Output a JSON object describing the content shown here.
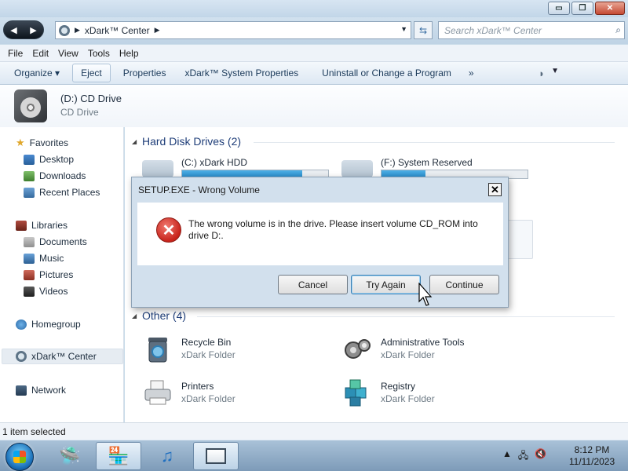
{
  "window": {
    "controls": {
      "minimize": "▭",
      "maximize": "❐",
      "close": "✕"
    }
  },
  "address": {
    "location": "xDark™ Center",
    "search_placeholder": "Search xDark™ Center"
  },
  "menu": [
    "File",
    "Edit",
    "View",
    "Tools",
    "Help"
  ],
  "commands": {
    "organize": "Organize ▾",
    "eject": "Eject",
    "properties": "Properties",
    "system_properties": "xDark™ System Properties",
    "uninstall": "Uninstall or Change a Program",
    "more": "»"
  },
  "details": {
    "name": "(D:) CD Drive",
    "type": "CD Drive"
  },
  "nav": {
    "favorites": "Favorites",
    "desktop": "Desktop",
    "downloads": "Downloads",
    "recent": "Recent Places",
    "libraries": "Libraries",
    "documents": "Documents",
    "music": "Music",
    "pictures": "Pictures",
    "videos": "Videos",
    "homegroup": "Homegroup",
    "center": "xDark™ Center",
    "network": "Network"
  },
  "groups": {
    "hard_disks": "Hard Disk Drives (2)",
    "other": "Other (4)"
  },
  "drives": [
    {
      "label": "(C:) xDark HDD",
      "used_fraction": 0.82
    },
    {
      "label": "(F:) System Reserved",
      "used_fraction": 0.3
    }
  ],
  "other_items": [
    {
      "name": "Recycle Bin",
      "type": "xDark Folder",
      "icon": "recycle-bin-icon"
    },
    {
      "name": "Administrative Tools",
      "type": "xDark Folder",
      "icon": "admin-tools-icon"
    },
    {
      "name": "Printers",
      "type": "xDark Folder",
      "icon": "printer-icon"
    },
    {
      "name": "Registry",
      "type": "xDark Folder",
      "icon": "registry-icon"
    }
  ],
  "dialog": {
    "title": "SETUP.EXE - Wrong Volume",
    "close": "✕",
    "message": "The wrong volume is in the drive. Please insert volume CD_ROM into drive D:.",
    "icon": "error-icon",
    "buttons": {
      "cancel": "Cancel",
      "try_again": "Try Again",
      "continue": "Continue"
    }
  },
  "status": {
    "text": "1 item selected"
  },
  "clock": {
    "time": "8:12 PM",
    "date": "11/11/2023"
  },
  "colors": {
    "progress": "#2487c7",
    "error": "#c8231b",
    "accent": "#1e3d78"
  }
}
